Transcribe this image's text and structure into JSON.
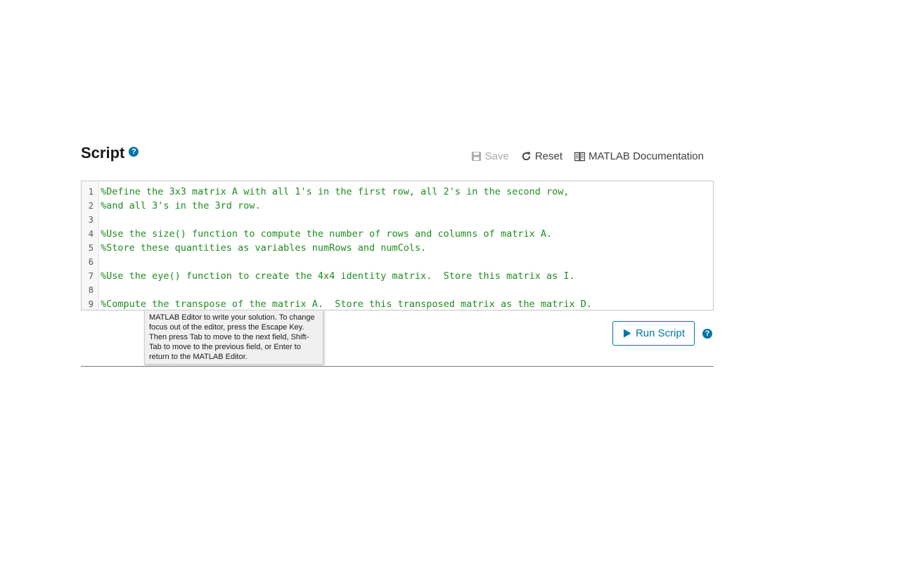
{
  "header": {
    "title": "Script",
    "help_glyph": "?"
  },
  "toolbar": {
    "save_label": "Save",
    "reset_label": "Reset",
    "docs_label": "MATLAB Documentation"
  },
  "editor": {
    "lines": [
      {
        "num": "1",
        "text": "%Define the 3x3 matrix A with all 1's in the first row, all 2's in the second row,"
      },
      {
        "num": "2",
        "text": "%and all 3's in the 3rd row."
      },
      {
        "num": "3",
        "text": ""
      },
      {
        "num": "4",
        "text": "%Use the size() function to compute the number of rows and columns of matrix A."
      },
      {
        "num": "5",
        "text": "%Store these quantities as variables numRows and numCols."
      },
      {
        "num": "6",
        "text": ""
      },
      {
        "num": "7",
        "text": "%Use the eye() function to create the 4x4 identity matrix.  Store this matrix as I."
      },
      {
        "num": "8",
        "text": ""
      },
      {
        "num": "9",
        "text": "%Compute the transpose of the matrix A.  Store this transposed matrix as the matrix D."
      }
    ]
  },
  "tooltip": {
    "text": "MATLAB Editor to write your solution. To change focus out of the editor, press the Escape Key. Then press Tab to move to the next field, Shift-Tab to move to the previous field, or Enter to return to the MATLAB Editor."
  },
  "run": {
    "label": "Run Script",
    "help_glyph": "?"
  },
  "colors": {
    "accent": "#0076a8",
    "comment": "#228b22",
    "disabled": "#aaaaaa"
  },
  "icons": {
    "save": "floppy-disk-icon",
    "reset": "refresh-icon",
    "docs": "book-icon",
    "run": "play-icon",
    "help": "question-circle-icon"
  }
}
